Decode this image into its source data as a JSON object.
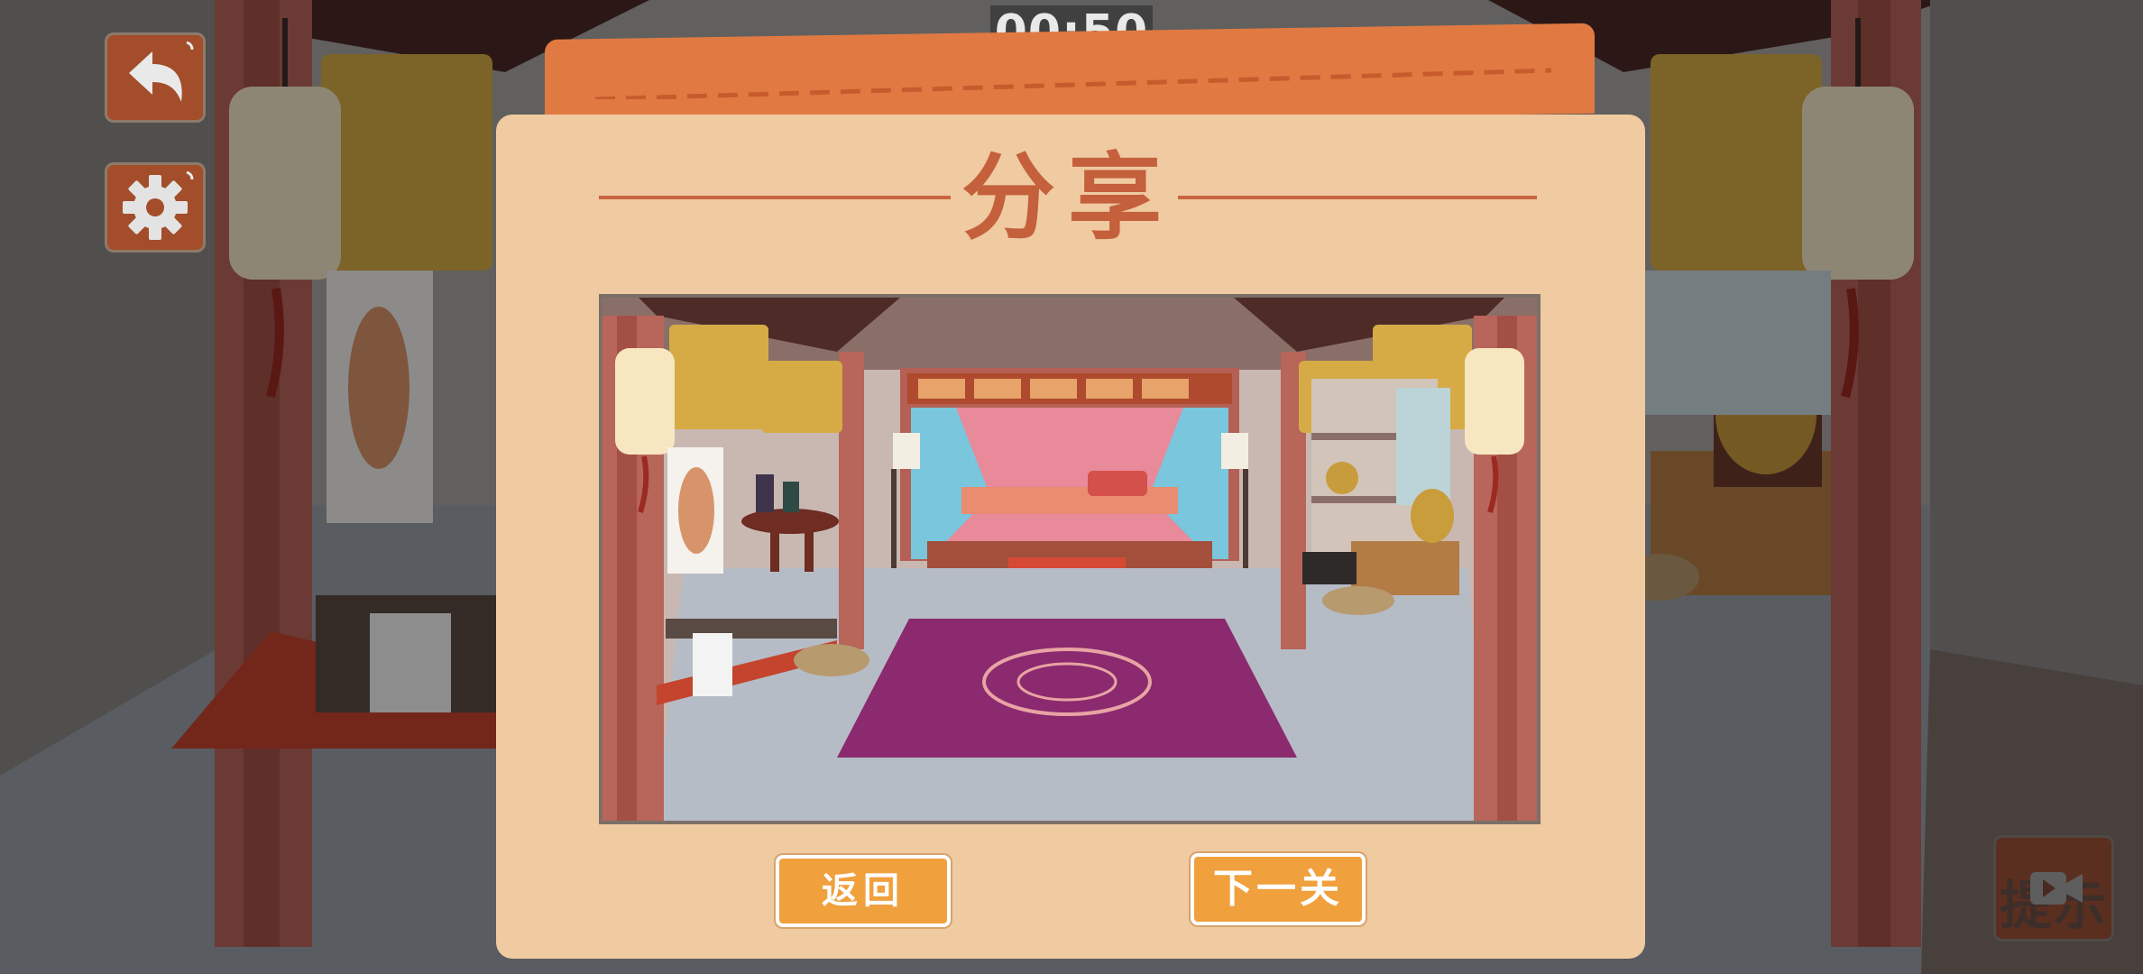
{
  "hud": {
    "timer": "00:50",
    "back_icon": "back-arrow-icon",
    "settings_icon": "gear-icon",
    "hint_label": "提示",
    "hint_icon": "video-icon"
  },
  "dialog": {
    "title": "分享",
    "screenshot_alt": "room-preview",
    "return_label": "返回",
    "next_label": "下一关"
  },
  "colors": {
    "dialog_bg": "#f0caa1",
    "dialog_tab": "#e07a42",
    "title": "#c4603c",
    "button": "#f0a03c",
    "hud_button": "#a34d2a"
  }
}
